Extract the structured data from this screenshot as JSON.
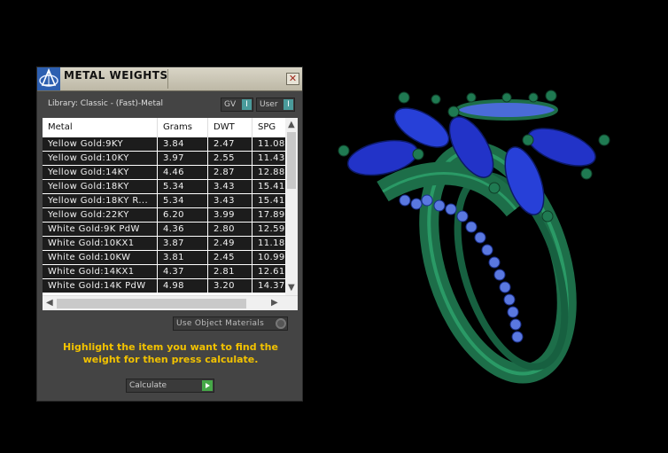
{
  "panel": {
    "title": "METAL WEIGHTS",
    "close_glyph": "✕",
    "library_label": "Library: Classic - (Fast)-Metal",
    "gv_toggle": "GV",
    "gv_indicator": "I",
    "user_toggle": "User",
    "user_indicator": "I",
    "table": {
      "columns": [
        "Metal",
        "Grams",
        "DWT",
        "SPG"
      ],
      "rows": [
        [
          "Yellow Gold:9KY",
          "3.84",
          "2.47",
          "11.08"
        ],
        [
          "Yellow Gold:10KY",
          "3.97",
          "2.55",
          "11.43"
        ],
        [
          "Yellow Gold:14KY",
          "4.46",
          "2.87",
          "12.88"
        ],
        [
          "Yellow Gold:18KY",
          "5.34",
          "3.43",
          "15.41"
        ],
        [
          "Yellow Gold:18KY R...",
          "5.34",
          "3.43",
          "15.41"
        ],
        [
          "Yellow Gold:22KY",
          "6.20",
          "3.99",
          "17.89"
        ],
        [
          "White Gold:9K PdW",
          "4.36",
          "2.80",
          "12.59"
        ],
        [
          "White Gold:10KX1",
          "3.87",
          "2.49",
          "11.18"
        ],
        [
          "White Gold:10KW",
          "3.81",
          "2.45",
          "10.99"
        ],
        [
          "White Gold:14KX1",
          "4.37",
          "2.81",
          "12.61"
        ],
        [
          "White Gold:14K PdW",
          "4.98",
          "3.20",
          "14.37"
        ]
      ]
    },
    "use_object_materials": "Use Object Materials",
    "instructions": "Highlight the item you want to find the weight for then press calculate.",
    "calculate_button": "Calculate"
  },
  "colors": {
    "panel_bg": "#444444",
    "instruction_text": "#f2c200",
    "ring_metal": "#1f7a52",
    "gem_blue": "#2233c8",
    "pave_blue": "#5a78e0"
  },
  "icons": {
    "title_logo": "rhino-logo-icon",
    "close": "close-icon",
    "calculate": "play-arrow-icon"
  }
}
